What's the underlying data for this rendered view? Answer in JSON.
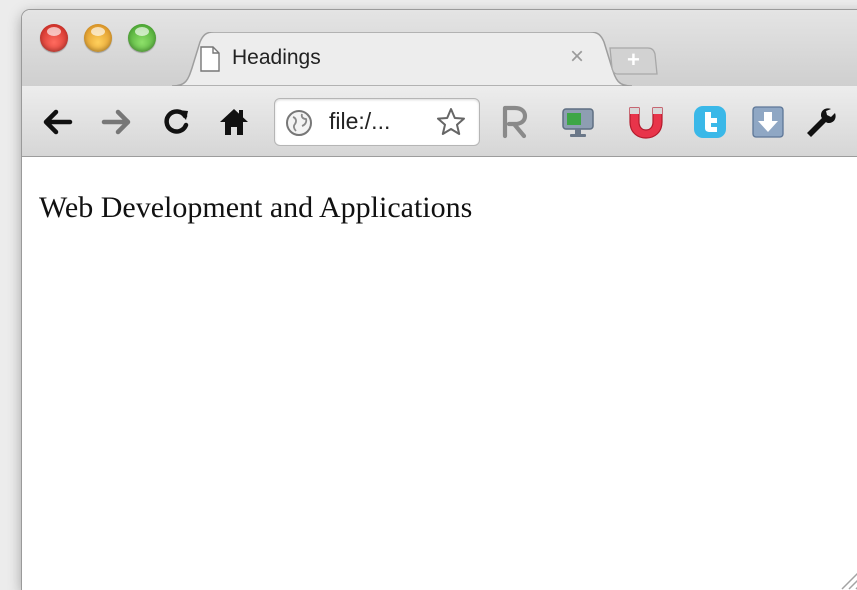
{
  "window": {
    "controls": [
      "close",
      "minimize",
      "zoom"
    ]
  },
  "tab": {
    "title": "Headings",
    "icon": "document-icon",
    "close_label": "×"
  },
  "new_tab": {
    "label": "+"
  },
  "toolbar": {
    "back_icon": "back-arrow-icon",
    "forward_icon": "forward-arrow-icon",
    "reload_icon": "reload-icon",
    "home_icon": "home-icon",
    "url": "file:/...",
    "bookmark_icon": "star-icon",
    "extensions": [
      "readability-r-icon",
      "monitor-extension-icon",
      "magnet-extension-icon",
      "twitter-icon",
      "download-extension-icon"
    ],
    "settings_icon": "wrench-icon"
  },
  "page": {
    "body_text": "Web Development and Applications"
  },
  "colors": {
    "close": "#e0443a",
    "minimize": "#f0a93a",
    "zoom": "#5fbe3f",
    "twitter": "#3ab8e8",
    "magnet": "#e8344a"
  }
}
